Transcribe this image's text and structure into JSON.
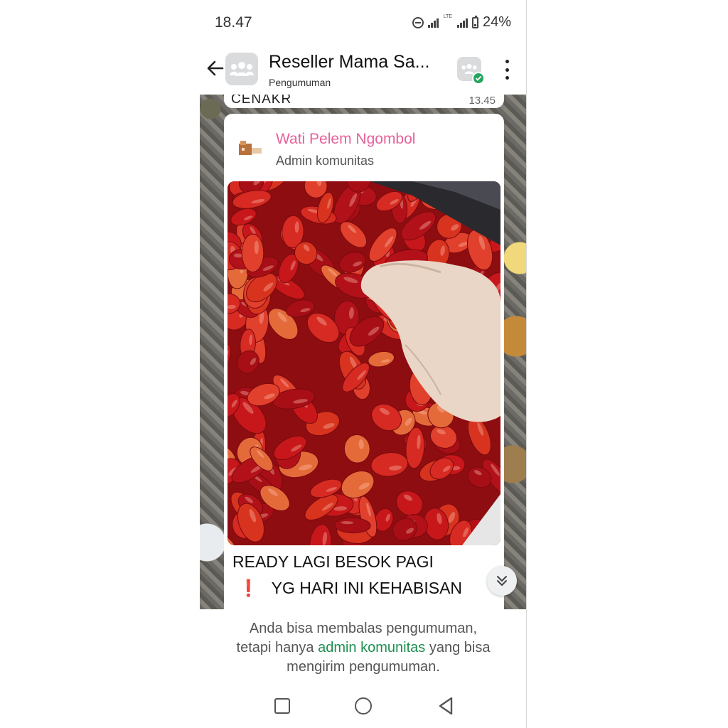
{
  "status_bar": {
    "time": "18.47",
    "battery": "24%",
    "network": "LTE"
  },
  "header": {
    "title": "Reseller Mama Sa...",
    "subtitle": "Pengumuman",
    "icons": [
      "back-arrow-icon",
      "group-avatar-icon",
      "community-icon",
      "more-options-icon"
    ]
  },
  "previous_message": {
    "text": "CENAKR",
    "time": "13.45"
  },
  "announcement": {
    "sender_name": "Wati Pelem Ngombol",
    "sender_role": "Admin komunitas",
    "line1": "READY LAGI BESOK PAGI",
    "line2_icon": "❗",
    "line2": "YG HARI INI KEHABISAN"
  },
  "footer": {
    "text_before": "Anda bisa membalas pengumuman,",
    "text_mid_before": "tetapi hanya ",
    "link": "admin komunitas",
    "text_mid_after": " yang bisa",
    "text_after": "mengirim pengumuman."
  },
  "colors": {
    "sender_name": "#e7609b",
    "link": "#1e8f4f",
    "verified_badge": "#25a55f"
  }
}
